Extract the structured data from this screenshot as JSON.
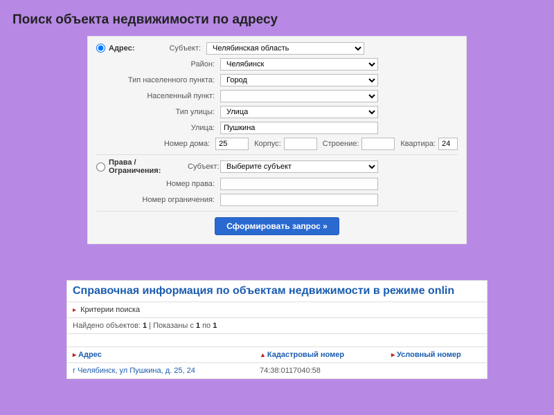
{
  "title": "Поиск объекта недвижимости по адресу",
  "form": {
    "addressRadioLabel": "Адрес:",
    "subjectLabel": "Субъект:",
    "subjectValue": "Челябинская область",
    "districtLabel": "Район:",
    "districtValue": "Челябинск",
    "settlementTypeLabel": "Тип населенного пункта:",
    "settlementTypeValue": "Город",
    "settlementLabel": "Населенный пункт:",
    "settlementValue": "",
    "streetTypeLabel": "Тип улицы:",
    "streetTypeValue": "Улица",
    "streetLabel": "Улица:",
    "streetValue": "Пушкина",
    "houseLabel": "Номер дома:",
    "houseValue": "25",
    "korpusLabel": "Корпус:",
    "korpusValue": "",
    "buildingLabel": "Строение:",
    "buildingValue": "",
    "flatLabel": "Квартира:",
    "flatValue": "24",
    "rightsRadioLabel": "Права / Ограничения:",
    "rightsSubjectLabel": "Субъект:",
    "rightsSubjectValue": "Выберите субъект",
    "rightNumberLabel": "Номер права:",
    "rightNumberValue": "",
    "restrictionNumberLabel": "Номер ограничения:",
    "restrictionNumberValue": "",
    "submitLabel": "Сформировать запрос »"
  },
  "results": {
    "title": "Справочная информация по объектам недвижимости в режиме onlin",
    "criteriaLabel": "Критерии поиска",
    "foundPrefix": "Найдено объектов: ",
    "foundCount": "1",
    "shownMid": " | Показаны с ",
    "shownFrom": "1",
    "shownTo": "1",
    "shownJoin": " по ",
    "colAddress": "Адрес",
    "colCadastral": "Кадастровый номер",
    "colConditional": "Условный номер",
    "rowAddress": "г Челябинск, ул Пушкина, д. 25, 24",
    "rowCadastral": "74:38:0117040:58",
    "rowConditional": ""
  }
}
